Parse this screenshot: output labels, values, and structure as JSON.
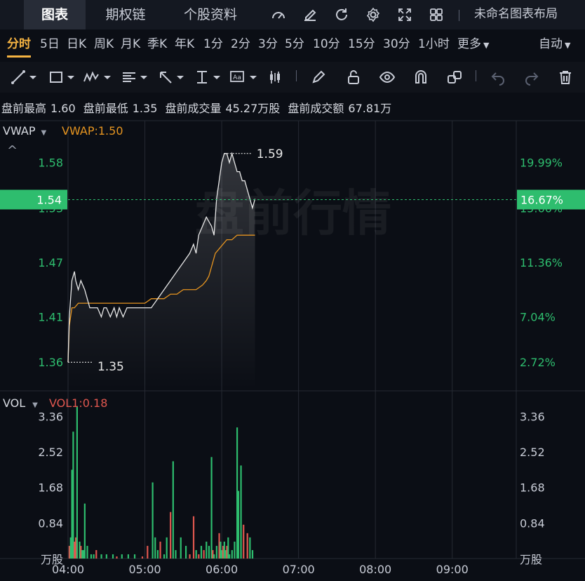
{
  "tabs": [
    "图表",
    "期权链",
    "个股资料"
  ],
  "layout_label": "未命名图表布局",
  "periods": [
    "分时",
    "5日",
    "日K",
    "周K",
    "月K",
    "季K",
    "年K",
    "1分",
    "2分",
    "3分",
    "5分",
    "10分",
    "15分",
    "30分",
    "1小时",
    "更多"
  ],
  "auto_label": "自动",
  "premarket": {
    "high_label": "盘前最高",
    "high": "1.60",
    "low_label": "盘前最低",
    "low": "1.35",
    "vol_label": "盘前成交量",
    "vol": "45.27万股",
    "amt_label": "盘前成交额",
    "amt": "67.81万"
  },
  "vwap": {
    "name": "VWAP",
    "label": "VWAP:1.50"
  },
  "vol_indicator": {
    "name": "VOL",
    "label": "VOL1:0.18"
  },
  "watermark": "盘前行情",
  "colors": {
    "up": "#2ebd6e",
    "down": "#e0574f",
    "vwap": "#e59420",
    "price": "#e8e8e8",
    "accent": "#f5b342"
  },
  "chart_data": [
    {
      "type": "line",
      "title": "",
      "price_axis_ticks": [
        "1.58",
        "1.53",
        "1.47",
        "1.41",
        "1.36"
      ],
      "pct_axis_ticks": [
        "19.99%",
        "15.66%",
        "11.36%",
        "7.04%",
        "2.72%"
      ],
      "ylim": [
        1.33,
        1.62
      ],
      "current_price": "1.54",
      "current_pct": "16.67%",
      "high_marker": "1.59",
      "low_marker": "1.35",
      "x_ticks": [
        "04:00",
        "05:00",
        "06:00",
        "07:00",
        "08:00",
        "09:00"
      ],
      "xlim": [
        0,
        350
      ],
      "series": [
        {
          "name": "price",
          "x": [
            0,
            1,
            3,
            5,
            6,
            8,
            10,
            13,
            15,
            17,
            20,
            23,
            26,
            28,
            30,
            33,
            36,
            38,
            40,
            43,
            46,
            50,
            55,
            60,
            65,
            70,
            75,
            80,
            85,
            90,
            95,
            98,
            100,
            102,
            105,
            108,
            112,
            114,
            116,
            118,
            120,
            122,
            124,
            126,
            128,
            130,
            132,
            134,
            136,
            138,
            140,
            142,
            144,
            146
          ],
          "y": [
            1.36,
            1.41,
            1.45,
            1.46,
            1.45,
            1.44,
            1.45,
            1.44,
            1.43,
            1.42,
            1.42,
            1.42,
            1.41,
            1.42,
            1.42,
            1.41,
            1.42,
            1.41,
            1.42,
            1.41,
            1.42,
            1.42,
            1.42,
            1.42,
            1.42,
            1.43,
            1.44,
            1.45,
            1.46,
            1.47,
            1.48,
            1.49,
            1.48,
            1.5,
            1.51,
            1.52,
            1.51,
            1.5,
            1.54,
            1.56,
            1.58,
            1.59,
            1.59,
            1.58,
            1.59,
            1.58,
            1.57,
            1.57,
            1.56,
            1.56,
            1.55,
            1.54,
            1.53,
            1.54
          ]
        },
        {
          "name": "VWAP",
          "x": [
            0,
            1,
            3,
            5,
            8,
            12,
            20,
            30,
            40,
            50,
            55,
            60,
            65,
            70,
            75,
            80,
            85,
            90,
            95,
            100,
            105,
            108,
            110,
            112,
            115,
            118,
            121,
            124,
            128,
            132,
            136,
            140,
            146
          ],
          "y": [
            1.36,
            1.4,
            1.42,
            1.42,
            1.425,
            1.425,
            1.425,
            1.425,
            1.425,
            1.425,
            1.425,
            1.425,
            1.43,
            1.43,
            1.43,
            1.435,
            1.435,
            1.44,
            1.44,
            1.44,
            1.445,
            1.45,
            1.455,
            1.465,
            1.48,
            1.485,
            1.49,
            1.495,
            1.495,
            1.5,
            1.5,
            1.5,
            1.5
          ]
        }
      ]
    },
    {
      "type": "bar",
      "title": "",
      "unit_label": "万股",
      "y_ticks": [
        "3.36",
        "2.52",
        "1.68",
        "0.84"
      ],
      "ylim": [
        0,
        3.6
      ],
      "xlim": [
        0,
        350
      ],
      "x": [
        1,
        2,
        3,
        4,
        5,
        6,
        7,
        9,
        10,
        11,
        12,
        13,
        15,
        18,
        20,
        22,
        26,
        30,
        35,
        38,
        42,
        47,
        52,
        58,
        62,
        66,
        68,
        70,
        72,
        75,
        77,
        80,
        82,
        84,
        88,
        92,
        95,
        98,
        100,
        102,
        104,
        106,
        108,
        110,
        112,
        113,
        114,
        116,
        118,
        119,
        120,
        121,
        122,
        123,
        124,
        125,
        126,
        128,
        130,
        132,
        133,
        135,
        137,
        140,
        142,
        144
      ],
      "values": [
        0.3,
        0.5,
        2.1,
        3.0,
        0.4,
        0.5,
        3.6,
        0.4,
        0.3,
        0.2,
        0.2,
        1.3,
        0.3,
        0.1,
        0.1,
        0.2,
        0.1,
        0.1,
        0.1,
        0.05,
        0.1,
        0.1,
        0.1,
        0.05,
        0.3,
        1.8,
        0.5,
        0.2,
        0.4,
        0.1,
        0.5,
        1.1,
        2.3,
        0.2,
        0.5,
        0.3,
        0.1,
        1.0,
        0.2,
        0.1,
        0.3,
        0.2,
        0.4,
        0.3,
        2.4,
        0.2,
        0.1,
        0.3,
        0.6,
        0.4,
        0.2,
        0.3,
        0.4,
        0.2,
        0.3,
        0.5,
        0.1,
        0.2,
        0.4,
        3.1,
        1.6,
        2.2,
        0.8,
        0.6,
        0.5,
        0.2
      ],
      "directions": [
        "d",
        "u",
        "u",
        "u",
        "d",
        "d",
        "u",
        "u",
        "d",
        "u",
        "u",
        "u",
        "u",
        "u",
        "u",
        "d",
        "u",
        "u",
        "u",
        "d",
        "u",
        "u",
        "u",
        "d",
        "d",
        "u",
        "u",
        "u",
        "d",
        "u",
        "u",
        "d",
        "u",
        "u",
        "u",
        "u",
        "d",
        "d",
        "u",
        "d",
        "u",
        "d",
        "u",
        "u",
        "u",
        "d",
        "u",
        "u",
        "d",
        "u",
        "u",
        "d",
        "u",
        "u",
        "d",
        "u",
        "u",
        "u",
        "u",
        "u",
        "u",
        "u",
        "d",
        "d",
        "u",
        "u"
      ]
    }
  ]
}
